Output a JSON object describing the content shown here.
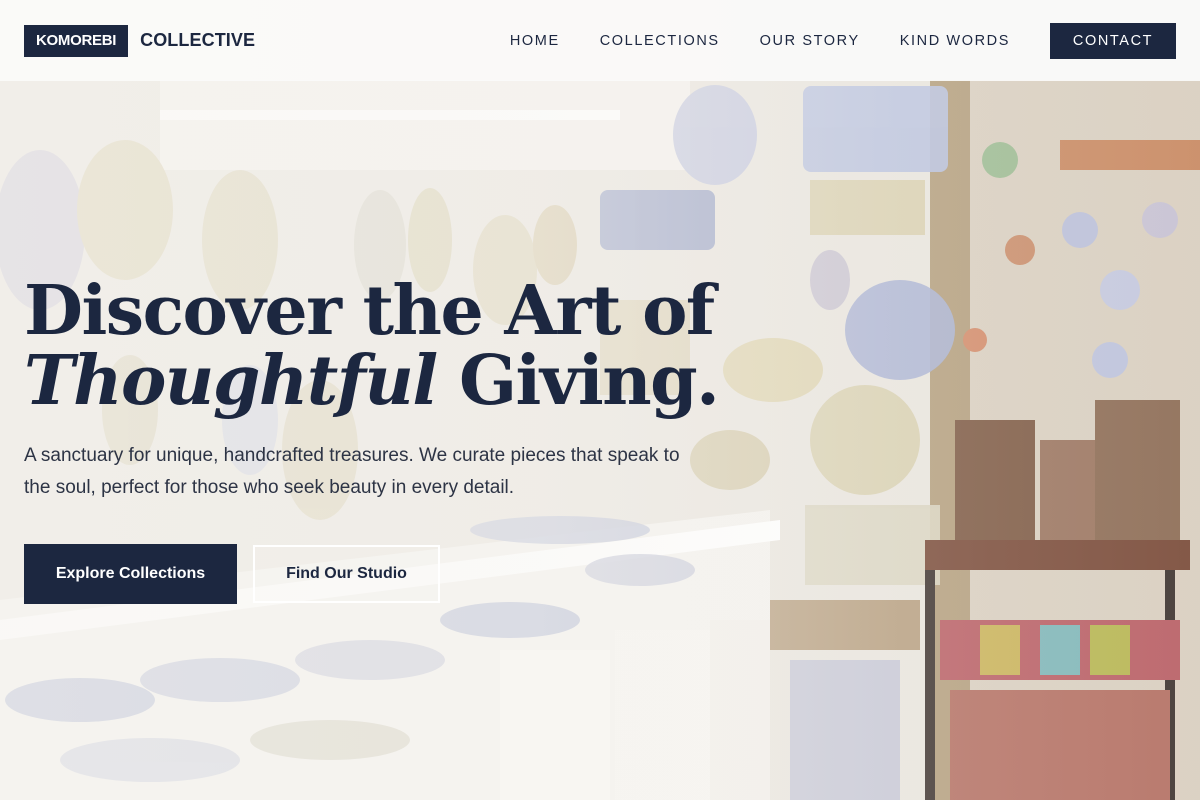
{
  "brand": {
    "logo_box": "KOMOREBI",
    "logo_text": "COLLECTIVE"
  },
  "nav": {
    "items": [
      {
        "label": "HOME"
      },
      {
        "label": "COLLECTIONS"
      },
      {
        "label": "OUR STORY"
      },
      {
        "label": "KIND WORDS"
      }
    ],
    "contact_label": "CONTACT"
  },
  "hero": {
    "headline_line1": "Discover the Art of",
    "headline_italic": "Thoughtful",
    "headline_rest": " Giving.",
    "subtext": "A sanctuary for unique, handcrafted treasures. We curate pieces that speak to the soul, perfect for those who seek beauty in every detail.",
    "primary_cta": "Explore Collections",
    "secondary_cta": "Find Our Studio",
    "background_image": "ceramic-shop-photo"
  },
  "colors": {
    "navy": "#1c2740",
    "nav_bg": "#fafaf9",
    "text_muted": "#2d3445"
  }
}
